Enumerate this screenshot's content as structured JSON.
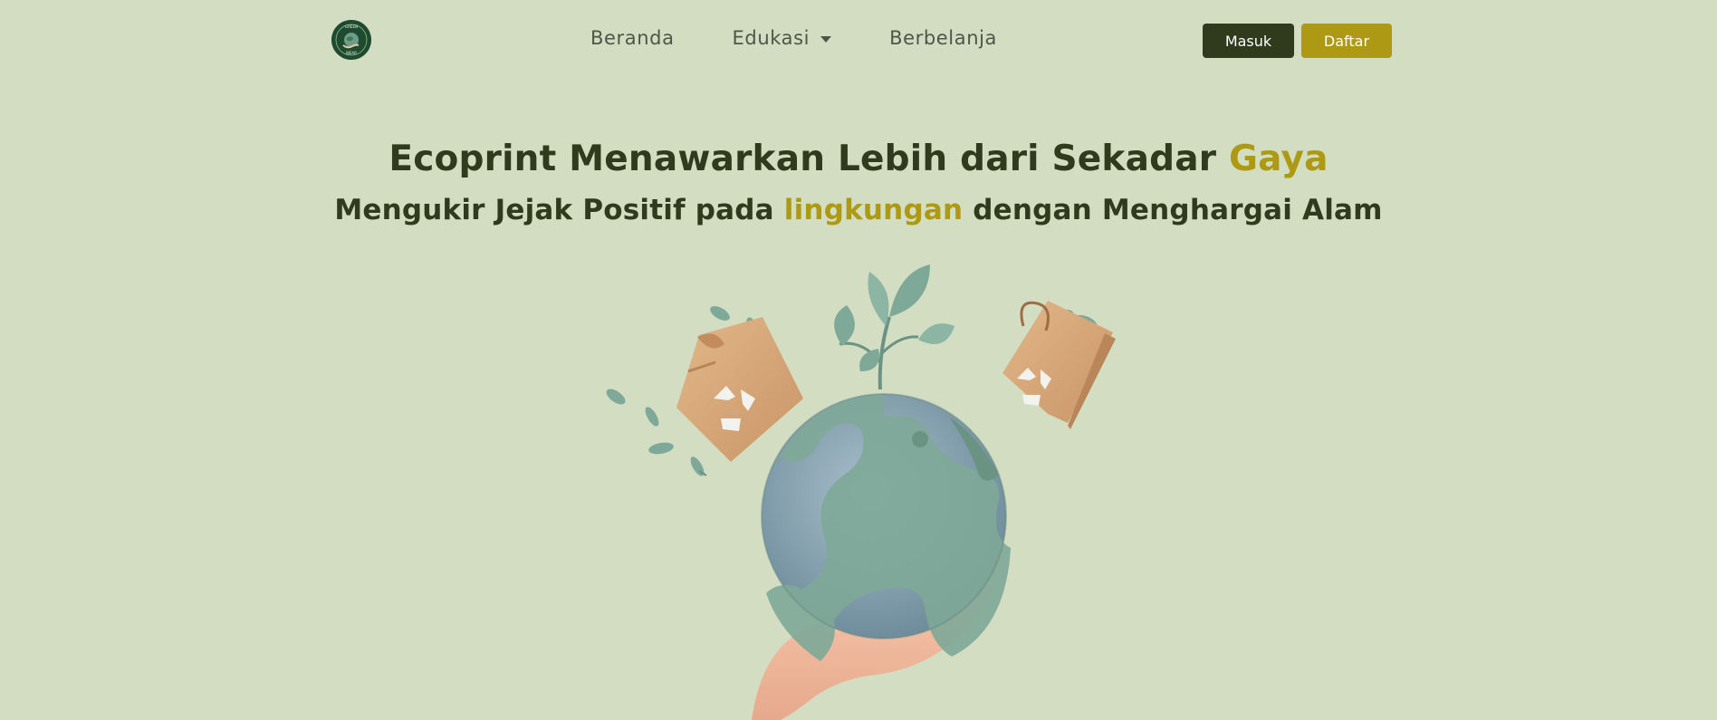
{
  "navbar": {
    "logo_text_top": "GREEN",
    "logo_text_bottom": "WEAR",
    "links": {
      "beranda": "Beranda",
      "edukasi": "Edukasi",
      "berbelanja": "Berbelanja"
    },
    "login_label": "Masuk",
    "register_label": "Daftar"
  },
  "hero": {
    "title_main": "Ecoprint Menawarkan Lebih dari Sekadar ",
    "title_accent": "Gaya",
    "subtitle_before": "Mengukir Jejak Positif pada ",
    "subtitle_accent": "lingkungan",
    "subtitle_after": " dengan Menghargai Alam"
  },
  "colors": {
    "background": "#d3ddc2",
    "primary_dark": "#2f3b1c",
    "accent_gold": "#ad9914",
    "nav_text": "#4f5548"
  },
  "icons": {
    "logo": "globe-hand-logo",
    "dropdown": "caret-down-icon",
    "illustration": "earth-in-hand-recycle-illustration"
  }
}
